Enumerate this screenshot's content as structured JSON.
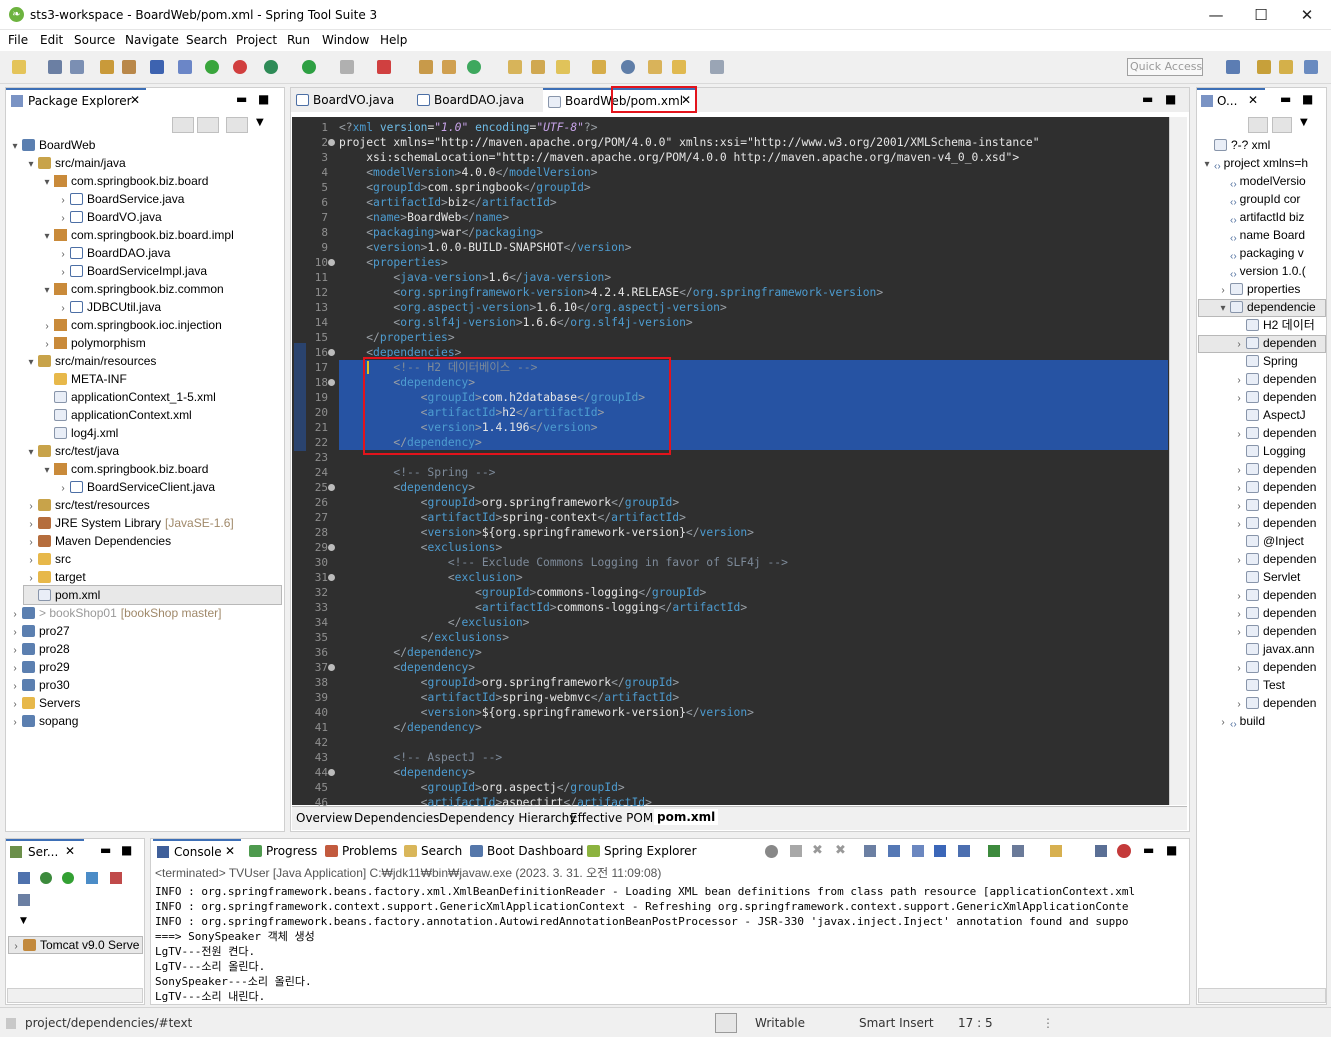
{
  "window": {
    "title": "sts3-workspace - BoardWeb/pom.xml - Spring Tool Suite 3"
  },
  "menu": [
    "File",
    "Edit",
    "Source",
    "Navigate",
    "Search",
    "Project",
    "Run",
    "Window",
    "Help"
  ],
  "quick_access": "Quick Access",
  "explorer": {
    "tab": "Package Explorer",
    "rows": [
      {
        "t": "▾",
        "icon": "ic-proj",
        "label": "BoardWeb"
      },
      {
        "t": "▾",
        "icon": "ic-src",
        "label": "src/main/java"
      },
      {
        "t": "▾",
        "icon": "ic-pkg",
        "label": "com.springbook.biz.board"
      },
      {
        "t": "›",
        "icon": "ic-java",
        "label": "BoardService.java"
      },
      {
        "t": "›",
        "icon": "ic-java",
        "label": "BoardVO.java"
      },
      {
        "t": "▾",
        "icon": "ic-pkg",
        "label": "com.springbook.biz.board.impl"
      },
      {
        "t": "›",
        "icon": "ic-java",
        "label": "BoardDAO.java"
      },
      {
        "t": "›",
        "icon": "ic-java",
        "label": "BoardServiceImpl.java"
      },
      {
        "t": "▾",
        "icon": "ic-pkg",
        "label": "com.springbook.biz.common"
      },
      {
        "t": "›",
        "icon": "ic-java",
        "label": "JDBCUtil.java"
      },
      {
        "t": "›",
        "icon": "ic-pkg",
        "label": "com.springbook.ioc.injection"
      },
      {
        "t": "›",
        "icon": "ic-pkg",
        "label": "polymorphism"
      },
      {
        "t": "▾",
        "icon": "ic-src",
        "label": "src/main/resources"
      },
      {
        "t": "",
        "icon": "ic-folder",
        "label": "META-INF"
      },
      {
        "t": "",
        "icon": "ic-xml",
        "label": "applicationContext_1-5.xml"
      },
      {
        "t": "",
        "icon": "ic-xml",
        "label": "applicationContext.xml"
      },
      {
        "t": "",
        "icon": "ic-xml",
        "label": "log4j.xml"
      },
      {
        "t": "▾",
        "icon": "ic-src",
        "label": "src/test/java"
      },
      {
        "t": "▾",
        "icon": "ic-pkg",
        "label": "com.springbook.biz.board"
      },
      {
        "t": "›",
        "icon": "ic-java",
        "label": "BoardServiceClient.java"
      },
      {
        "t": "›",
        "icon": "ic-src",
        "label": "src/test/resources"
      },
      {
        "t": "›",
        "icon": "ic-lib",
        "label": "JRE System Library",
        "extra": "[JavaSE-1.6]"
      },
      {
        "t": "›",
        "icon": "ic-lib",
        "label": "Maven Dependencies"
      },
      {
        "t": "›",
        "icon": "ic-folder",
        "label": "src"
      },
      {
        "t": "›",
        "icon": "ic-folder",
        "label": "target"
      },
      {
        "t": "",
        "icon": "ic-xml",
        "label": "pom.xml"
      },
      {
        "t": "›",
        "icon": "ic-proj",
        "label": "> bookShop01",
        "extra": "[bookShop master]"
      },
      {
        "t": "›",
        "icon": "ic-proj",
        "label": "pro27"
      },
      {
        "t": "›",
        "icon": "ic-proj",
        "label": "pro28"
      },
      {
        "t": "›",
        "icon": "ic-proj",
        "label": "pro29"
      },
      {
        "t": "›",
        "icon": "ic-proj",
        "label": "pro30"
      },
      {
        "t": "›",
        "icon": "ic-folder",
        "label": "Servers"
      },
      {
        "t": "›",
        "icon": "ic-proj",
        "label": "sopang"
      }
    ]
  },
  "editor_tabs": [
    "BoardVO.java",
    "BoardDAO.java",
    "BoardWeb/pom.xml"
  ],
  "code_lines": [
    "<?xml version=\"1.0\" encoding=\"UTF-8\"?>",
    "<project xmlns=\"http://maven.apache.org/POM/4.0.0\" xmlns:xsi=\"http://www.w3.org/2001/XMLSchema-instance\"",
    "    xsi:schemaLocation=\"http://maven.apache.org/POM/4.0.0 http://maven.apache.org/maven-v4_0_0.xsd\">",
    "    <modelVersion>4.0.0</modelVersion>",
    "    <groupId>com.springbook</groupId>",
    "    <artifactId>biz</artifactId>",
    "    <name>BoardWeb</name>",
    "    <packaging>war</packaging>",
    "    <version>1.0.0-BUILD-SNAPSHOT</version>",
    "    <properties>",
    "        <java-version>1.6</java-version>",
    "        <org.springframework-version>4.2.4.RELEASE</org.springframework-version>",
    "        <org.aspectj-version>1.6.10</org.aspectj-version>",
    "        <org.slf4j-version>1.6.6</org.slf4j-version>",
    "    </properties>",
    "    <dependencies>",
    "        <!-- H2 데이터베이스 -->",
    "        <dependency>",
    "            <groupId>com.h2database</groupId>",
    "            <artifactId>h2</artifactId>",
    "            <version>1.4.196</version>",
    "        </dependency>",
    "",
    "        <!-- Spring -->",
    "        <dependency>",
    "            <groupId>org.springframework</groupId>",
    "            <artifactId>spring-context</artifactId>",
    "            <version>${org.springframework-version}</version>",
    "            <exclusions>",
    "                <!-- Exclude Commons Logging in favor of SLF4j -->",
    "                <exclusion>",
    "                    <groupId>commons-logging</groupId>",
    "                    <artifactId>commons-logging</artifactId>",
    "                </exclusion>",
    "            </exclusions>",
    "        </dependency>",
    "        <dependency>",
    "            <groupId>org.springframework</groupId>",
    "            <artifactId>spring-webmvc</artifactId>",
    "            <version>${org.springframework-version}</version>",
    "        </dependency>",
    "",
    "        <!-- AspectJ -->",
    "        <dependency>",
    "            <groupId>org.aspectj</groupId>",
    "            <artifactId>aspectjrt</artifactId>"
  ],
  "editor_bottom_tabs": [
    "Overview",
    "Dependencies",
    "Dependency Hierarchy",
    "Effective POM",
    "pom.xml"
  ],
  "outline": {
    "tab": "O...",
    "rows": [
      {
        "t": "",
        "icon": "ic-xml",
        "label": "?-? xml"
      },
      {
        "t": "▾",
        "icon": "ic-tag",
        "label": "project xmlns=h"
      },
      {
        "t": "",
        "icon": "ic-tag",
        "label": "modelVersio"
      },
      {
        "t": "",
        "icon": "ic-tag",
        "label": "groupId  cor"
      },
      {
        "t": "",
        "icon": "ic-tag",
        "label": "artifactId  biz"
      },
      {
        "t": "",
        "icon": "ic-tag",
        "label": "name  Board"
      },
      {
        "t": "",
        "icon": "ic-tag",
        "label": "packaging  v"
      },
      {
        "t": "",
        "icon": "ic-tag",
        "label": "version  1.0.("
      },
      {
        "t": "›",
        "icon": "ic-xml",
        "label": "properties"
      },
      {
        "t": "▾",
        "icon": "ic-xml",
        "label": "dependencie"
      },
      {
        "t": "",
        "icon": "ic-xml",
        "label": "H2 데이터"
      },
      {
        "t": "›",
        "icon": "ic-xml",
        "label": "dependen"
      },
      {
        "t": "",
        "icon": "ic-xml",
        "label": "Spring"
      },
      {
        "t": "›",
        "icon": "ic-xml",
        "label": "dependen"
      },
      {
        "t": "›",
        "icon": "ic-xml",
        "label": "dependen"
      },
      {
        "t": "",
        "icon": "ic-xml",
        "label": "AspectJ"
      },
      {
        "t": "›",
        "icon": "ic-xml",
        "label": "dependen"
      },
      {
        "t": "",
        "icon": "ic-xml",
        "label": "Logging"
      },
      {
        "t": "›",
        "icon": "ic-xml",
        "label": "dependen"
      },
      {
        "t": "›",
        "icon": "ic-xml",
        "label": "dependen"
      },
      {
        "t": "›",
        "icon": "ic-xml",
        "label": "dependen"
      },
      {
        "t": "›",
        "icon": "ic-xml",
        "label": "dependen"
      },
      {
        "t": "",
        "icon": "ic-xml",
        "label": "@Inject"
      },
      {
        "t": "›",
        "icon": "ic-xml",
        "label": "dependen"
      },
      {
        "t": "",
        "icon": "ic-xml",
        "label": "Servlet"
      },
      {
        "t": "›",
        "icon": "ic-xml",
        "label": "dependen"
      },
      {
        "t": "›",
        "icon": "ic-xml",
        "label": "dependen"
      },
      {
        "t": "›",
        "icon": "ic-xml",
        "label": "dependen"
      },
      {
        "t": "",
        "icon": "ic-xml",
        "label": "javax.ann"
      },
      {
        "t": "›",
        "icon": "ic-xml",
        "label": "dependen"
      },
      {
        "t": "",
        "icon": "ic-xml",
        "label": "Test"
      },
      {
        "t": "›",
        "icon": "ic-xml",
        "label": "dependen"
      },
      {
        "t": "›",
        "icon": "ic-tag",
        "label": "build"
      }
    ]
  },
  "servers": {
    "tab": "Ser...",
    "item": "Tomcat v9.0 Serve"
  },
  "console_tabs": [
    "Console",
    "Progress",
    "Problems",
    "Search",
    "Boot Dashboard",
    "Spring Explorer"
  ],
  "console_header": "<terminated> TVUser [Java Application] C:₩jdk11₩bin₩javaw.exe (2023. 3. 31. 오전 11:09:08)",
  "console_lines": [
    "INFO : org.springframework.beans.factory.xml.XmlBeanDefinitionReader - Loading XML bean definitions from class path resource [applicationContext.xml",
    "INFO : org.springframework.context.support.GenericXmlApplicationContext - Refreshing org.springframework.context.support.GenericXmlApplicationConte",
    "INFO : org.springframework.beans.factory.annotation.AutowiredAnnotationBeanPostProcessor - JSR-330 'javax.inject.Inject' annotation found and suppo",
    "===> SonySpeaker 객체 생성",
    "LgTV---전원 켠다.",
    "LgTV---소리 올린다.",
    "SonySpeaker---소리 올린다.",
    "LgTV---소리 내린다."
  ],
  "status": {
    "path": "project/dependencies/#text",
    "writable": "Writable",
    "insert": "Smart Insert",
    "position": "17 : 5"
  }
}
